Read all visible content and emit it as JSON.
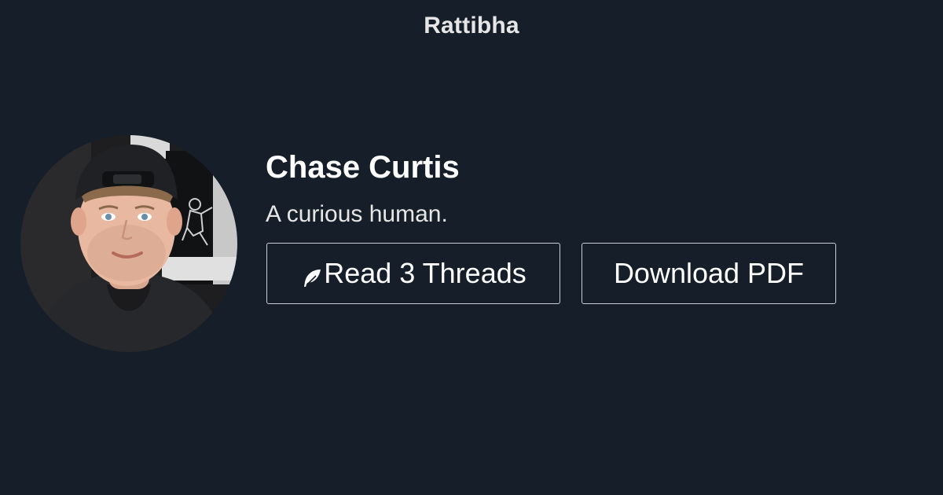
{
  "brand": {
    "name": "Rattibha"
  },
  "profile": {
    "name": "Chase Curtis",
    "bio": "A curious human.",
    "avatar": "profile-photo"
  },
  "actions": {
    "read_threads": {
      "icon": "feather-icon",
      "label": "Read 3 Threads"
    },
    "download_pdf": {
      "label": "Download PDF"
    }
  },
  "colors": {
    "background": "#161f29",
    "text": "#ffffff",
    "button_border": "#c9ced4"
  }
}
